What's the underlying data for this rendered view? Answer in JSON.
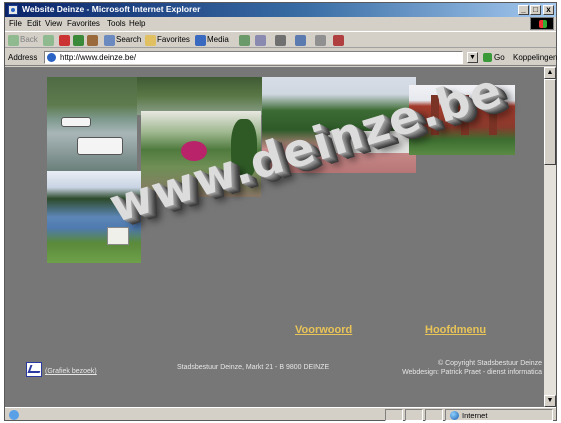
{
  "window": {
    "title": "Website Deinze - Microsoft Internet Explorer",
    "controls": {
      "minimize": "_",
      "maximize": "□",
      "close": "x"
    }
  },
  "menu": [
    "File",
    "Edit",
    "View",
    "Favorites",
    "Tools",
    "Help"
  ],
  "toolbar": {
    "back": "Back",
    "search": "Search",
    "favorites": "Favorites",
    "media": "Media"
  },
  "address": {
    "label": "Address",
    "url": "http://www.deinze.be/",
    "go": "Go",
    "links": "Koppelingen"
  },
  "page": {
    "site_title": "www.deinze.be",
    "nav": {
      "voorwoord": "Voorwoord",
      "hoofdmenu": "Hoofdmenu"
    },
    "stats_link": "(Grafiek bezoek)",
    "footer_address": "Stadsbestuur Deinze, Markt 21 - B 9800 DEINZE",
    "footer_copyright": "© Copyright Stadsbestuur Deinze",
    "footer_webdesign": "Webdesign: Patrick Praet - dienst informatica"
  },
  "status": {
    "zone": "Internet"
  },
  "colors": {
    "page_background": "#777777",
    "nav_link": "#e8c458",
    "titlebar": "#0a246a"
  }
}
